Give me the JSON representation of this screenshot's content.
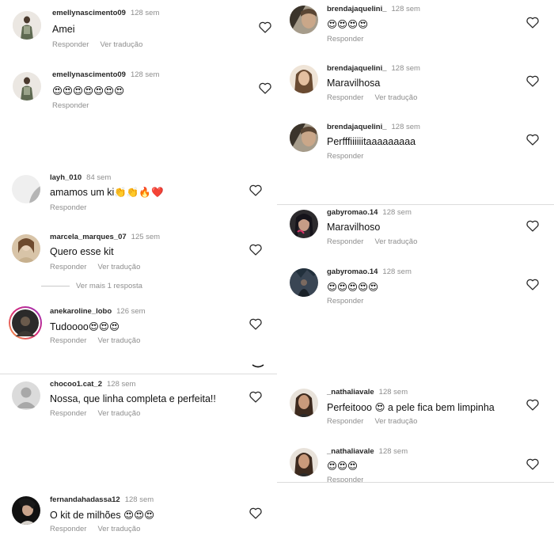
{
  "labels": {
    "reply": "Responder",
    "translate": "Ver tradução"
  },
  "left_comments": [
    {
      "user": "emellynascimento09",
      "time": "128 sem",
      "text": "Amei",
      "translate": true
    },
    {
      "user": "emellynascimento09",
      "time": "128 sem",
      "text": "😍😍😍😍😍😍😍",
      "translate": false
    },
    {
      "user": "layh_010",
      "time": "84 sem",
      "text": "amamos um ki👏👏🔥❤️",
      "translate": false
    },
    {
      "user": "marcela_marques_07",
      "time": "125 sem",
      "text": "Quero esse kit",
      "translate": true
    },
    {
      "user": "anekaroline_lobo",
      "time": "126 sem",
      "text": "Tudoooo😍😍😍",
      "translate": true
    },
    {
      "user": "chocoo1.cat_2",
      "time": "128 sem",
      "text": "Nossa, que linha completa e perfeita!!",
      "translate": true
    },
    {
      "user": "fernandahadassa12",
      "time": "128 sem",
      "text": "O kit de milhões 😍😍😍",
      "translate": true
    }
  ],
  "view_more_replies": "Ver mais 1 resposta",
  "right_comments": [
    {
      "user": "brendajaquelini_",
      "time": "128 sem",
      "text": "😍😍😍😍",
      "translate": false
    },
    {
      "user": "brendajaquelini_",
      "time": "128 sem",
      "text": "Maravilhosa",
      "translate": true
    },
    {
      "user": "brendajaquelini_",
      "time": "128 sem",
      "text": "Perfffiiiiiitaaaaaaaaa",
      "translate": false
    },
    {
      "user": "gabyromao.14",
      "time": "128 sem",
      "text": "Maravilhoso",
      "translate": true
    },
    {
      "user": "gabyromao.14",
      "time": "128 sem",
      "text": "😍😍😍😍😍",
      "translate": false
    },
    {
      "user": "_nathaliavale",
      "time": "128 sem",
      "text": "Perfeitooo 😍 a pele fica bem limpinha",
      "translate": true
    },
    {
      "user": "_nathaliavale",
      "time": "128 sem",
      "text": "😍😍😍",
      "translate": false
    }
  ],
  "icons": {
    "like": "heart-outline-icon",
    "default_avatar": "default-avatar-icon"
  },
  "colors": {
    "meta_gray": "#8e8e8e",
    "username": "#262626",
    "story_ring": "#d62976"
  }
}
